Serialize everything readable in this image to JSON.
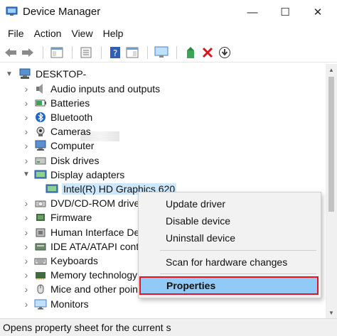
{
  "window": {
    "title": "Device Manager",
    "minimize_glyph": "—",
    "maximize_glyph": "☐",
    "close_glyph": "✕"
  },
  "menu": [
    "File",
    "Action",
    "View",
    "Help"
  ],
  "toolbar": {
    "icons": [
      "back-arrow-icon",
      "forward-arrow-icon",
      "console-tree-icon",
      "properties-sheet-icon",
      "help-icon",
      "action-pane-icon",
      "monitor-icon",
      "update-driver-icon",
      "uninstall-icon",
      "download-icon"
    ]
  },
  "tree": {
    "root": "DESKTOP-",
    "items": [
      {
        "label": "Audio inputs and outputs",
        "icon": "speaker-icon",
        "expanded": false
      },
      {
        "label": "Batteries",
        "icon": "battery-icon",
        "expanded": false
      },
      {
        "label": "Bluetooth",
        "icon": "bluetooth-icon",
        "expanded": false
      },
      {
        "label": "Cameras",
        "icon": "camera-icon",
        "expanded": false
      },
      {
        "label": "Computer",
        "icon": "computer-icon",
        "expanded": false
      },
      {
        "label": "Disk drives",
        "icon": "disk-drive-icon",
        "expanded": false
      },
      {
        "label": "Display adapters",
        "icon": "display-adapter-icon",
        "expanded": true
      },
      {
        "label": "Intel(R) HD Graphics 620",
        "icon": "display-adapter-icon",
        "child": true,
        "selected": true
      },
      {
        "label": "DVD/CD-ROM drives",
        "icon": "dvd-icon",
        "expanded": false
      },
      {
        "label": "Firmware",
        "icon": "firmware-icon",
        "expanded": false
      },
      {
        "label": "Human Interface Devices",
        "icon": "hid-icon",
        "expanded": false
      },
      {
        "label": "IDE ATA/ATAPI controllers",
        "icon": "ide-icon",
        "expanded": false
      },
      {
        "label": "Keyboards",
        "icon": "keyboard-icon",
        "expanded": false
      },
      {
        "label": "Memory technology devices",
        "icon": "memory-icon",
        "expanded": false
      },
      {
        "label": "Mice and other pointing devices",
        "icon": "mouse-icon",
        "expanded": false
      },
      {
        "label": "Monitors",
        "icon": "monitor-icon",
        "expanded": false
      }
    ]
  },
  "context_menu": {
    "update_driver": "Update driver",
    "disable_device": "Disable device",
    "uninstall_device": "Uninstall device",
    "scan": "Scan for hardware changes",
    "properties": "Properties"
  },
  "status": "Opens property sheet for the current s",
  "colors": {
    "highlight_border": "#e81123",
    "highlight_fill": "#91c9f7",
    "selection": "#cce8ff"
  }
}
